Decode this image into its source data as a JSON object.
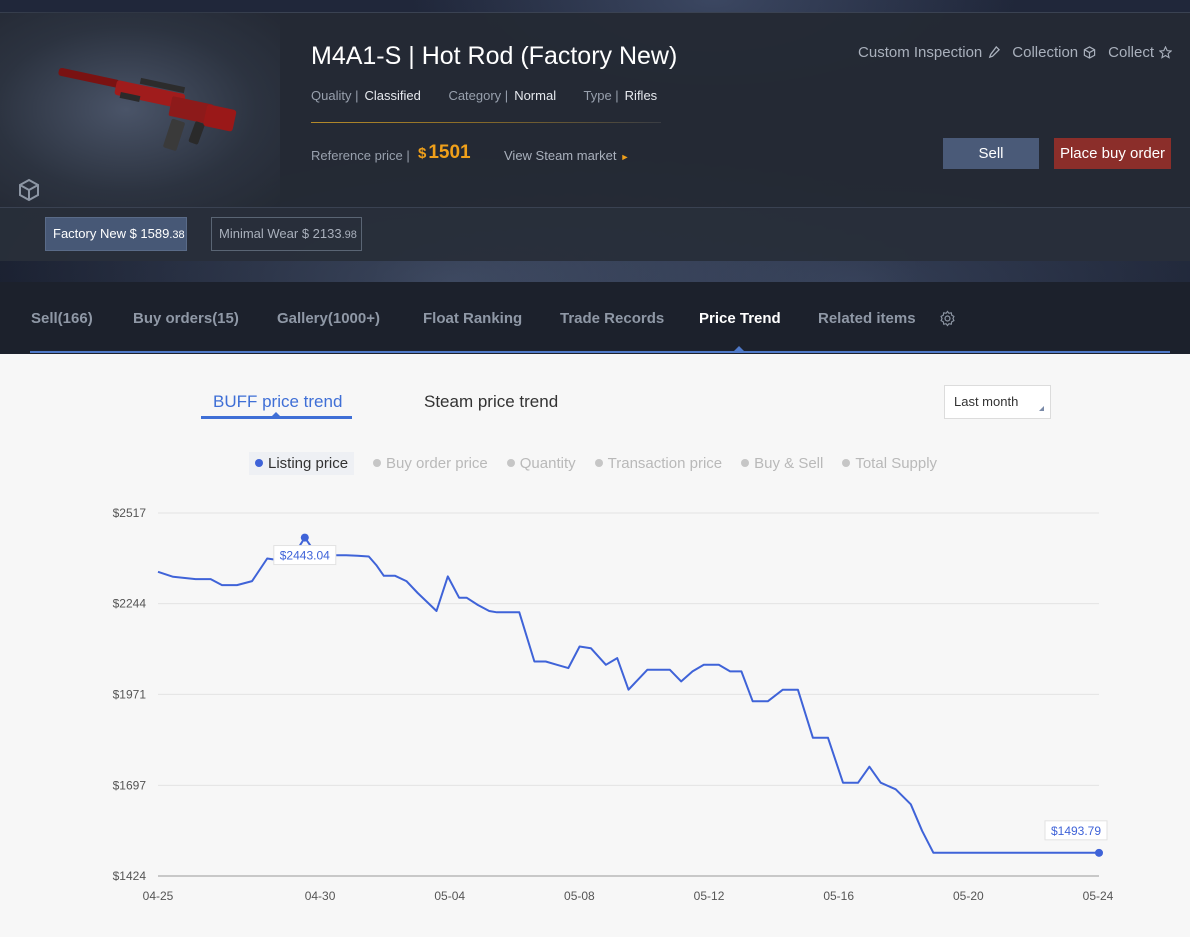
{
  "item": {
    "title": "M4A1-S | Hot Rod (Factory New)",
    "quality_label": "Quality |",
    "quality": "Classified",
    "category_label": "Category |",
    "category": "Normal",
    "type_label": "Type |",
    "type": "Rifles",
    "reference_label": "Reference price |",
    "reference_currency": "$",
    "reference_price": "1501",
    "steam_market_link": "View Steam market",
    "weapon_color": "#8b1a1a"
  },
  "top_actions": {
    "custom_inspection": "Custom Inspection",
    "collection": "Collection",
    "collect": "Collect"
  },
  "buttons": {
    "sell": "Sell",
    "place_buy_order": "Place buy order"
  },
  "wear_options": [
    {
      "label": "Factory New $ 1589",
      "cents": ".38",
      "active": true
    },
    {
      "label": "Minimal Wear $ 2133",
      "cents": ".98",
      "active": false
    }
  ],
  "tabs": [
    {
      "label": "Sell(166)"
    },
    {
      "label": "Buy orders(15)"
    },
    {
      "label": "Gallery(1000+)"
    },
    {
      "label": "Float Ranking"
    },
    {
      "label": "Trade Records"
    },
    {
      "label": "Price Trend"
    },
    {
      "label": "Related items"
    }
  ],
  "trend_tabs": {
    "buff": "BUFF price trend",
    "steam": "Steam price trend"
  },
  "period": "Last month",
  "legend": [
    {
      "label": "Listing price",
      "active": true
    },
    {
      "label": "Buy order price",
      "active": false
    },
    {
      "label": "Quantity",
      "active": false
    },
    {
      "label": "Transaction price",
      "active": false
    },
    {
      "label": "Buy & Sell",
      "active": false
    },
    {
      "label": "Total Supply",
      "active": false
    }
  ],
  "colors": {
    "accent_blue": "#3f63d8",
    "reference_gold": "#f0a01a",
    "buy_order_red": "#8b2e2a",
    "sell_blue": "#4a5a78"
  },
  "chart_data": {
    "type": "line",
    "series": [
      {
        "name": "Listing price",
        "x": [
          0,
          0.4,
          1.0,
          1.4,
          1.7,
          2.1,
          2.5,
          2.9,
          3.5,
          3.9,
          4.3,
          4.6,
          5.0,
          5.3,
          5.6,
          5.8,
          6.0,
          6.3,
          6.6,
          6.9,
          7.4,
          7.7,
          8.0,
          8.2,
          8.5,
          8.8,
          9.0,
          9.3,
          9.6,
          10.0,
          10.3,
          10.6,
          10.9,
          11.2,
          11.5,
          11.9,
          12.2,
          12.5,
          13.0,
          13.3,
          13.6,
          13.9,
          14.2,
          14.5,
          14.9,
          15.2,
          15.5,
          15.8,
          16.2,
          16.6,
          17.0,
          17.4,
          17.8,
          18.2,
          18.6,
          18.9,
          19.2,
          19.6,
          20.0,
          20.3,
          20.6,
          21.0,
          21.3,
          21.6,
          21.9,
          22.3,
          22.6,
          22.9,
          23.2,
          23.6,
          23.9,
          24.3,
          24.6,
          25.0
        ],
        "y": [
          2340,
          2325,
          2318,
          2318,
          2300,
          2300,
          2312,
          2380,
          2370,
          2443.04,
          2378,
          2390,
          2390,
          2388,
          2386,
          2360,
          2328,
          2328,
          2312,
          2276,
          2222,
          2326,
          2262,
          2262,
          2240,
          2222,
          2218,
          2218,
          2218,
          2070,
          2070,
          2060,
          2050,
          2115,
          2110,
          2060,
          2080,
          1985,
          2045,
          2045,
          2045,
          2010,
          2040,
          2060,
          2060,
          2040,
          2040,
          1950,
          1950,
          1985,
          1985,
          1840,
          1840,
          1705,
          1705,
          1753,
          1705,
          1685,
          1640,
          1560,
          1493.79,
          1493.79,
          1493.79,
          1493.79,
          1493.79,
          1493.79,
          1493.79,
          1493.79,
          1493.79,
          1493.79,
          1493.79,
          1493.79,
          1493.79,
          1493.79
        ]
      }
    ],
    "xticks": [
      "04-25",
      "04-30",
      "05-04",
      "05-08",
      "05-12",
      "05-16",
      "05-20",
      "05-24"
    ],
    "yticks": [
      "$2517",
      "$2244",
      "$1971",
      "$1697",
      "$1424"
    ],
    "ylim": [
      1424,
      2517
    ],
    "annotations": [
      {
        "label": "$2443.04"
      },
      {
        "label": "$1493.79"
      }
    ],
    "grid": true,
    "legend_position": "top-center"
  }
}
